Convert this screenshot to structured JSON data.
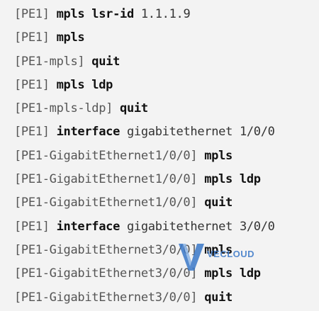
{
  "lines": [
    {
      "prompt": "[PE1]",
      "command": "mpls lsr-id",
      "args": "1.1.1.9"
    },
    {
      "prompt": "[PE1]",
      "command": "mpls",
      "args": ""
    },
    {
      "prompt": "[PE1-mpls]",
      "command": "quit",
      "args": ""
    },
    {
      "prompt": "[PE1]",
      "command": "mpls ldp",
      "args": ""
    },
    {
      "prompt": "[PE1-mpls-ldp]",
      "command": "quit",
      "args": ""
    },
    {
      "prompt": "[PE1]",
      "command": "interface",
      "args": "gigabitethernet 1/0/0"
    },
    {
      "prompt": "[PE1-GigabitEthernet1/0/0]",
      "command": "mpls",
      "args": ""
    },
    {
      "prompt": "[PE1-GigabitEthernet1/0/0]",
      "command": "mpls ldp",
      "args": ""
    },
    {
      "prompt": "[PE1-GigabitEthernet1/0/0]",
      "command": "quit",
      "args": ""
    },
    {
      "prompt": "[PE1]",
      "command": "interface",
      "args": "gigabitethernet 3/0/0"
    },
    {
      "prompt": "[PE1-GigabitEthernet3/0/0]",
      "command": "mpls",
      "args": ""
    },
    {
      "prompt": "[PE1-GigabitEthernet3/0/0]",
      "command": "mpls ldp",
      "args": ""
    },
    {
      "prompt": "[PE1-GigabitEthernet3/0/0]",
      "command": "quit",
      "args": ""
    }
  ],
  "watermark": {
    "text": "VECLOUD",
    "icon": "v-logo-icon",
    "color": "#3a78c8"
  }
}
